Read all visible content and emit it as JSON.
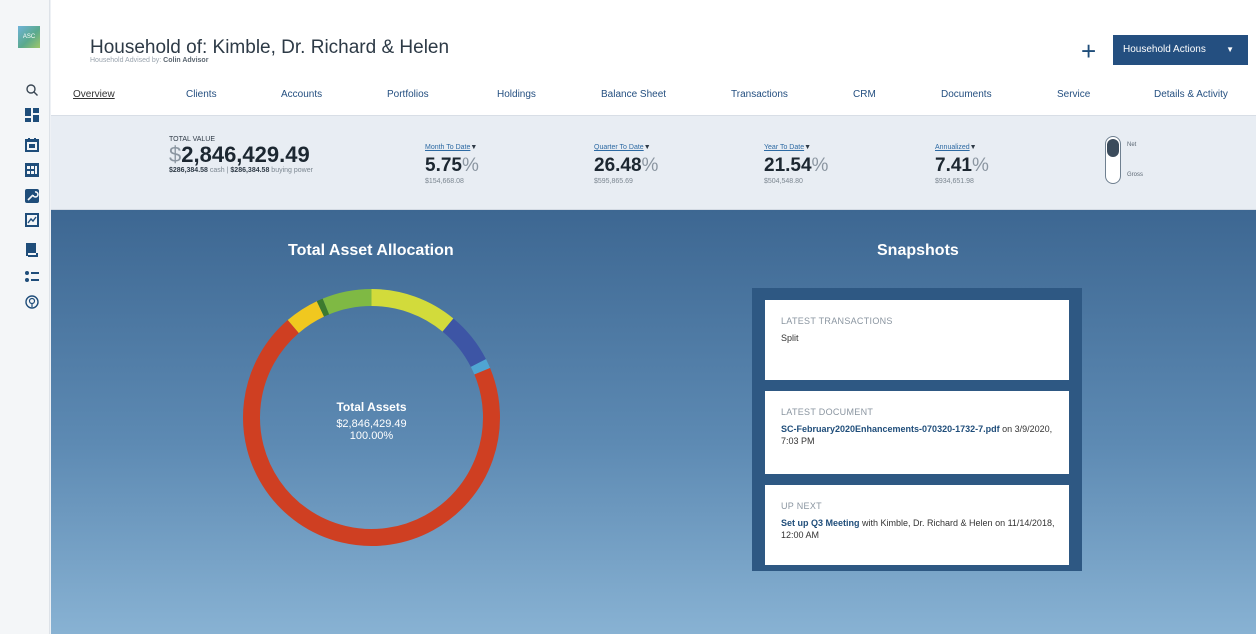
{
  "app": {
    "logo": "ASC"
  },
  "header": {
    "title": "Household of: Kimble, Dr. Richard & Helen",
    "subtitle_prefix": "Household Advised by:",
    "advisor": "Colin Advisor",
    "plus": "+",
    "actions_label": "Household Actions",
    "actions_caret": "▼"
  },
  "nav": {
    "items": [
      "Overview",
      "Clients",
      "Accounts",
      "Portfolios",
      "Holdings",
      "Balance Sheet",
      "Transactions",
      "CRM",
      "Documents",
      "Service",
      "Details & Activity"
    ],
    "active_index": 0
  },
  "sidebar_icons": [
    "search-icon",
    "dashboard-icon",
    "calendar-icon",
    "grid-icon",
    "wrench-icon",
    "chart-icon",
    "book-icon",
    "list-icon",
    "support-icon"
  ],
  "stats": {
    "total": {
      "label": "TOTAL VALUE",
      "dollar": "$",
      "value": "2,846,429.49",
      "cash": "$286,384.58",
      "cash_label": "cash |",
      "bp": "$286,384.58",
      "bp_label": "buying power"
    },
    "mtd": {
      "label": "Month To Date",
      "value": "5.75",
      "pct": "%",
      "sub": "$154,668.08"
    },
    "qtd": {
      "label": "Quarter To Date",
      "value": "26.48",
      "pct": "%",
      "sub": "$595,865.69"
    },
    "ytd": {
      "label": "Year To Date",
      "value": "21.54",
      "pct": "%",
      "sub": "$504,548.80"
    },
    "ann": {
      "label": "Annualized",
      "value": "7.41",
      "pct": "%",
      "sub": "$934,651.98"
    },
    "dropdown_glyph": "▼",
    "toggle": {
      "on": "Net",
      "off": "Gross",
      "selected": "Net"
    }
  },
  "allocation": {
    "title": "Total Asset Allocation",
    "center_label": "Total Assets",
    "center_amount": "$2,846,429.49",
    "center_pct": "100.00%"
  },
  "chart_data": {
    "type": "pie",
    "title": "Total Asset Allocation",
    "segments": [
      {
        "value": 11.0,
        "color": "#d2db3b"
      },
      {
        "value": 6.5,
        "color": "#3d55a5"
      },
      {
        "value": 1.2,
        "color": "#4fa5d2"
      },
      {
        "value": 70.0,
        "color": "#cf3f22"
      },
      {
        "value": 4.3,
        "color": "#f0c81f"
      },
      {
        "value": 0.8,
        "color": "#3c7a2e"
      },
      {
        "value": 6.2,
        "color": "#7fb944"
      }
    ]
  },
  "snapshots": {
    "title": "Snapshots",
    "cards": [
      {
        "caption": "LATEST TRANSACTIONS",
        "text": "Split"
      },
      {
        "caption": "LATEST DOCUMENT",
        "link": "SC-February2020Enhancements-070320-1732-7.pdf",
        "text": " on 3/9/2020, 7:03 PM"
      },
      {
        "caption": "UP NEXT",
        "link": "Set up Q3 Meeting",
        "text": " with Kimble, Dr. Richard & Helen on 11/14/2018, 12:00 AM"
      }
    ]
  },
  "colors": {
    "brand": "#244f80",
    "main_top": "#3d6792",
    "main_bottom": "#88b2d3"
  }
}
